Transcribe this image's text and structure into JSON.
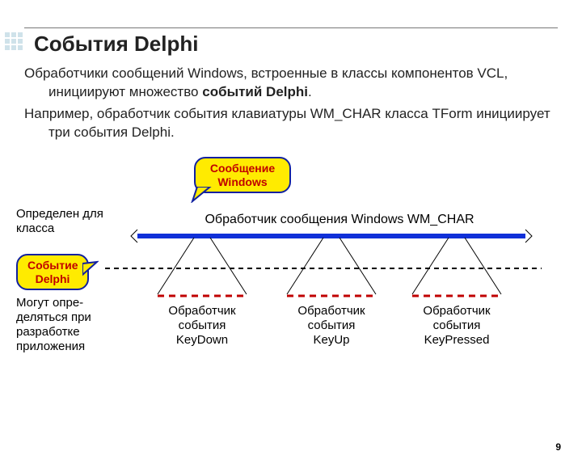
{
  "title": "События Delphi",
  "para1_pre": "Обработчики сообщений Windows, встроенные в классы компонентов VCL, инициируют множество ",
  "para1_bold": "событий Delphi",
  "para1_post": ".",
  "para2": "Например, обработчик события клавиатуры WM_CHAR класса TForm инициирует три события Delphi.",
  "callout_message": "Сообщение\nWindows",
  "callout_event": "Событие\nDelphi",
  "diagram": {
    "left_top": "Определен\nдля класса",
    "left_bottom": "Могут опре-\nделяться при\nразработке\nприложения",
    "main_handler": "Обработчик сообщения Windows WM_CHAR",
    "handlers": [
      "Обработчик\nсобытия\nKeyDown",
      "Обработчик\nсобытия\nKeyUp",
      "Обработчик\nсобытия\nKeyPressed"
    ]
  },
  "page_number": "9"
}
